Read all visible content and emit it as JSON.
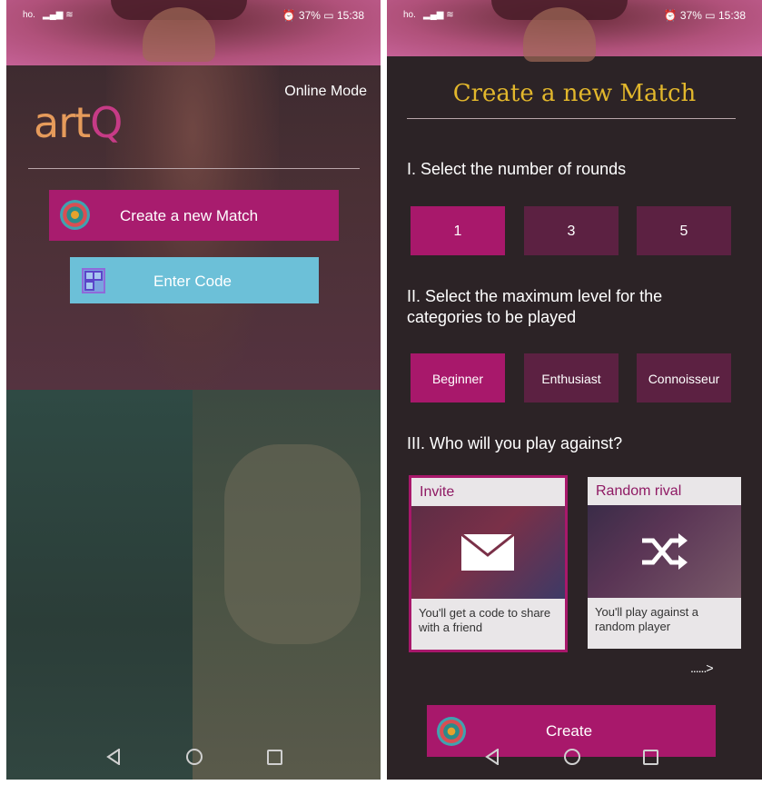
{
  "status_bar": {
    "carrier": "ho.",
    "battery": "37%",
    "time": "15:38"
  },
  "left_screen": {
    "mode_label": "Online Mode",
    "logo_text": "artQ",
    "create_match_label": "Create a new Match",
    "enter_code_label": "Enter Code"
  },
  "right_screen": {
    "title": "Create a new Match",
    "rounds_label": "I. Select the number of rounds",
    "rounds_options": [
      "1",
      "3",
      "5"
    ],
    "rounds_selected": "1",
    "level_label": "II. Select the maximum level for the categories to be played",
    "level_options": [
      "Beginner",
      "Enthusiast",
      "Connoisseur"
    ],
    "level_selected": "Beginner",
    "opponent_label": "III. Who will you play against?",
    "cards": [
      {
        "title": "Invite",
        "description": "You'll get a code to share with a friend",
        "icon": "envelope-icon",
        "selected": true
      },
      {
        "title": "Random rival",
        "description": "You'll play against a random player",
        "icon": "shuffle-icon",
        "selected": false
      }
    ],
    "more_indicator": "......>",
    "create_label": "Create"
  },
  "colors": {
    "primary": "#a8186b",
    "unselected": "#5c2142",
    "accent_gold": "#e2b72c",
    "enter_code": "#6cc0d8",
    "logo_orange": "#e69b5b"
  }
}
